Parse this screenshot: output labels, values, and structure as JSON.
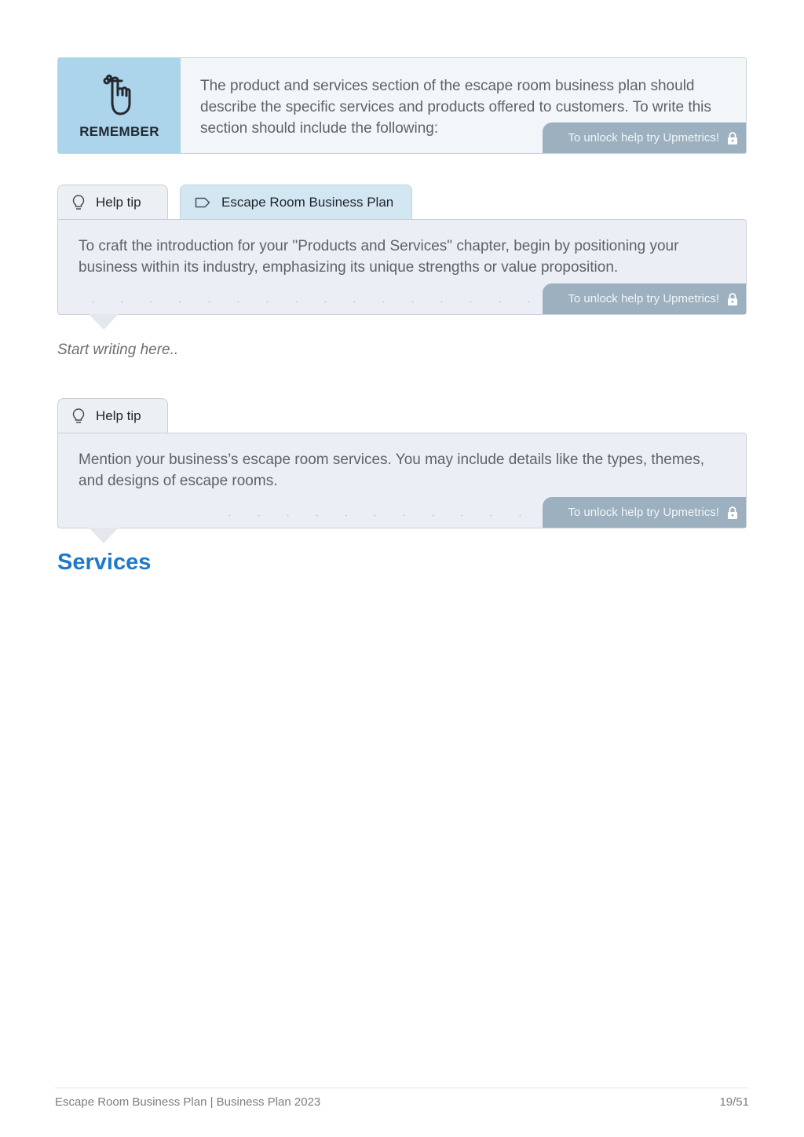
{
  "remember": {
    "label": "REMEMBER",
    "icon": "finger-string-reminder-icon",
    "text": "The product and services section of the escape room business plan should describe the specific services and products offered to customers. To write this section should include the following:",
    "unlock_label": "To unlock help try Upmetrics!"
  },
  "help_tip_1": {
    "tab_label": "Help tip",
    "tab_icon": "lightbulb-icon",
    "example_tab_label": "Escape Room Business Plan",
    "example_tab_icon": "tag-icon",
    "text": "To craft the introduction for your \"Products and Services\" chapter, begin by positioning your business within its industry, emphasizing its unique strengths or value proposition.",
    "unlock_label": "To unlock help try Upmetrics!"
  },
  "editor": {
    "placeholder": "Start writing here.."
  },
  "help_tip_2": {
    "tab_label": "Help tip",
    "tab_icon": "lightbulb-icon",
    "text": "Mention your business’s escape room services. You may include details like the types, themes, and designs of escape rooms.",
    "unlock_label": "To unlock help try Upmetrics!"
  },
  "section": {
    "title": "Services"
  },
  "footer": {
    "left": "Escape Room Business Plan | Business Plan 2023",
    "page": "19/51"
  },
  "colors": {
    "accent": "#2079c6",
    "remember_panel": "#acd4ea",
    "unlock_button": "#9cb0bf",
    "tip_background": "#ebeff5"
  }
}
